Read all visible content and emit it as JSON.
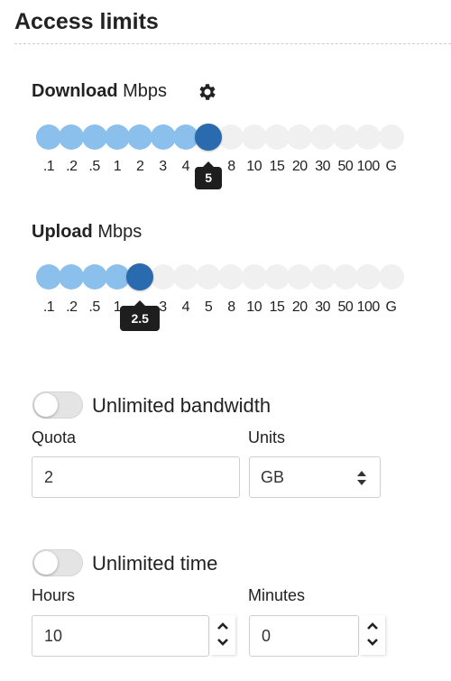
{
  "section": {
    "title": "Access limits"
  },
  "download": {
    "label_bold": "Download",
    "label_unit": "Mbps",
    "ticks": [
      ".1",
      ".2",
      ".5",
      "1",
      "2",
      "3",
      "4",
      "5",
      "8",
      "10",
      "15",
      "20",
      "30",
      "50",
      "100",
      "G"
    ],
    "selected_index": 7,
    "value": "5"
  },
  "upload": {
    "label_bold": "Upload",
    "label_unit": "Mbps",
    "ticks": [
      ".1",
      ".2",
      ".5",
      "1",
      "2.5",
      "3",
      "4",
      "5",
      "8",
      "10",
      "15",
      "20",
      "30",
      "50",
      "100",
      "G"
    ],
    "selected_index": 4,
    "value": "2.5"
  },
  "bandwidth": {
    "toggle_label": "Unlimited bandwidth",
    "toggle_on": false,
    "quota_label": "Quota",
    "quota_value": "2",
    "units_label": "Units",
    "units_value": "GB"
  },
  "time": {
    "toggle_label": "Unlimited time",
    "toggle_on": false,
    "hours_label": "Hours",
    "hours_value": "10",
    "minutes_label": "Minutes",
    "minutes_value": "0"
  },
  "colors": {
    "slider_filled": "#8cc0ec",
    "slider_handle": "#2a6aae",
    "slider_empty": "#f0f0f0",
    "tooltip": "#1e1e1e"
  },
  "icons": {
    "settings": "gear-icon",
    "units_select": "sort-arrows-icon",
    "increment": "chevron-up-icon",
    "decrement": "chevron-down-icon"
  }
}
